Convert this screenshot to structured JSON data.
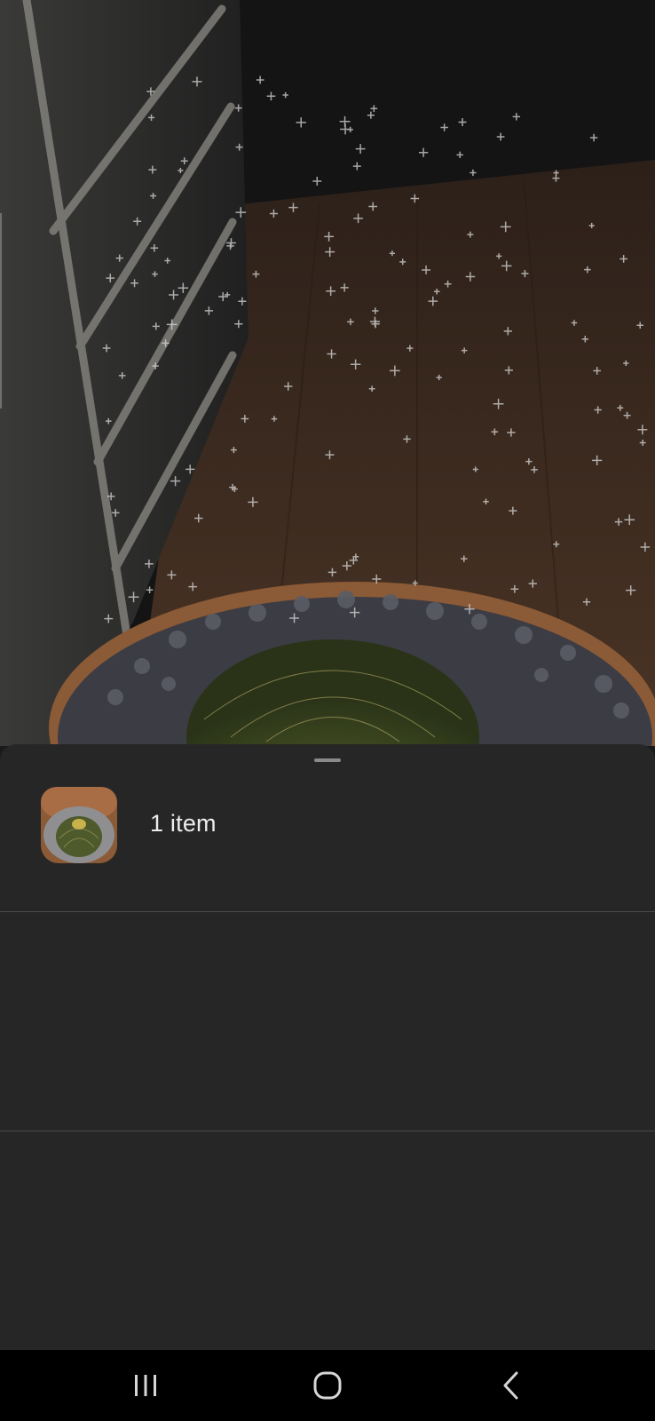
{
  "sheet": {
    "item_count_label": "1 item"
  },
  "icons": {
    "recents": "recents-icon",
    "home": "home-icon",
    "back": "back-icon",
    "thumbnail": "cactus-pot-thumbnail"
  },
  "colors": {
    "sheet_background": "#262626",
    "divider": "#4a4a4a",
    "text_primary": "#ededed",
    "nav_background": "#000000"
  }
}
